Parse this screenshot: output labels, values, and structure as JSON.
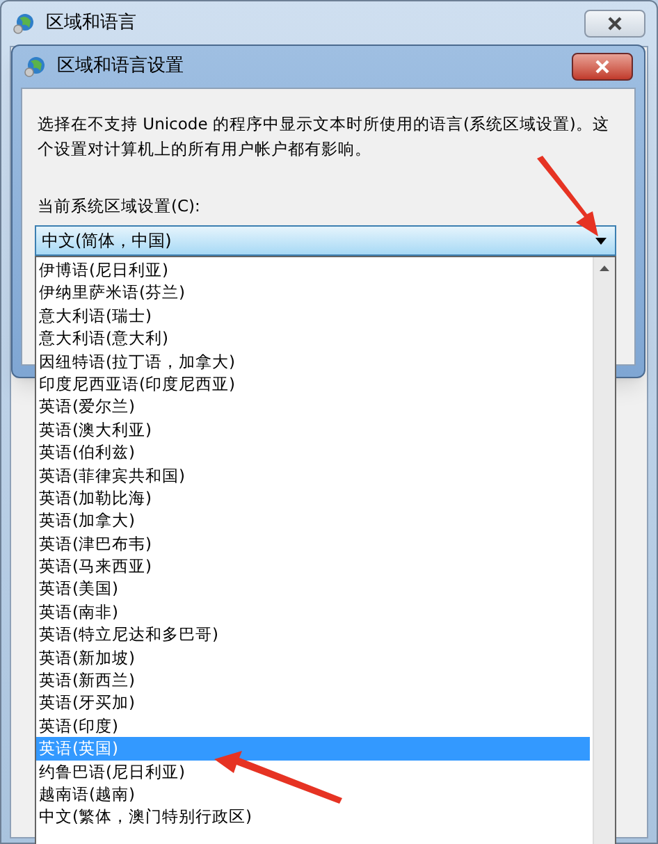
{
  "window": {
    "title": "区域和语言"
  },
  "dialog": {
    "title": "区域和语言设置",
    "description": "选择在不支持 Unicode 的程序中显示文本时所使用的语言(系统区域设置)。这个设置对计算机上的所有用户帐户都有影响。",
    "locale_label": "当前系统区域设置(C):",
    "locale_value": "中文(简体，中国)"
  },
  "dropdown": {
    "items": [
      {
        "label": "伊博语(尼日利亚)",
        "selected": false
      },
      {
        "label": "伊纳里萨米语(芬兰)",
        "selected": false
      },
      {
        "label": "意大利语(瑞士)",
        "selected": false
      },
      {
        "label": "意大利语(意大利)",
        "selected": false
      },
      {
        "label": "因纽特语(拉丁语，加拿大)",
        "selected": false
      },
      {
        "label": "印度尼西亚语(印度尼西亚)",
        "selected": false
      },
      {
        "label": "英语(爱尔兰)",
        "selected": false
      },
      {
        "label": "英语(澳大利亚)",
        "selected": false
      },
      {
        "label": "英语(伯利兹)",
        "selected": false
      },
      {
        "label": "英语(菲律宾共和国)",
        "selected": false
      },
      {
        "label": "英语(加勒比海)",
        "selected": false
      },
      {
        "label": "英语(加拿大)",
        "selected": false
      },
      {
        "label": "英语(津巴布韦)",
        "selected": false
      },
      {
        "label": "英语(马来西亚)",
        "selected": false
      },
      {
        "label": "英语(美国)",
        "selected": false
      },
      {
        "label": "英语(南非)",
        "selected": false
      },
      {
        "label": "英语(特立尼达和多巴哥)",
        "selected": false
      },
      {
        "label": "英语(新加坡)",
        "selected": false
      },
      {
        "label": "英语(新西兰)",
        "selected": false
      },
      {
        "label": "英语(牙买加)",
        "selected": false
      },
      {
        "label": "英语(印度)",
        "selected": false
      },
      {
        "label": "英语(英国)",
        "selected": true
      },
      {
        "label": "约鲁巴语(尼日利亚)",
        "selected": false
      },
      {
        "label": "越南语(越南)",
        "selected": false
      },
      {
        "label": "中文(繁体，澳门特别行政区)",
        "selected": false
      }
    ]
  }
}
